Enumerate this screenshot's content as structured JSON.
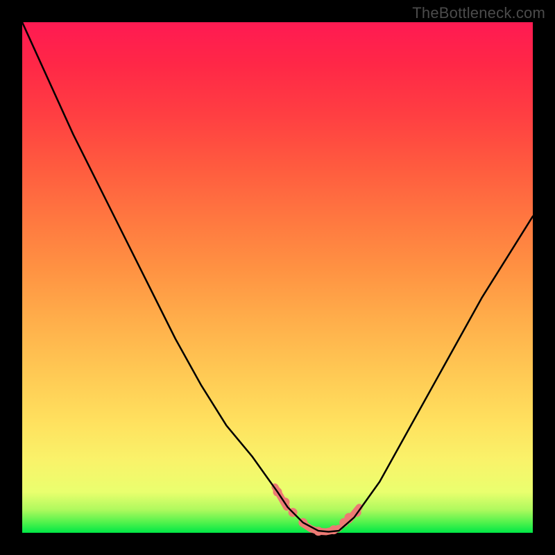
{
  "watermark": "TheBottleneck.com",
  "colors": {
    "frame": "#000000",
    "curve": "#000000",
    "accent": "#ed7a74",
    "gradient_top": "#ff1a52",
    "gradient_bottom": "#00e846"
  },
  "chart_data": {
    "type": "line",
    "title": "",
    "xlabel": "",
    "ylabel": "",
    "xlim": [
      0,
      100
    ],
    "ylim": [
      0,
      100
    ],
    "grid": false,
    "legend": false,
    "x": [
      0,
      5,
      10,
      15,
      20,
      25,
      30,
      35,
      40,
      45,
      50,
      52,
      55,
      58,
      60,
      62,
      65,
      70,
      75,
      80,
      85,
      90,
      95,
      100
    ],
    "y": [
      100,
      89,
      78,
      68,
      58,
      48,
      38,
      29,
      21,
      15,
      8,
      5,
      2,
      0.4,
      0.2,
      0.4,
      3,
      10,
      19,
      28,
      37,
      46,
      54,
      62
    ],
    "accent_markers_x": [
      50,
      51.5,
      53,
      55,
      58,
      61,
      63,
      64,
      65.5
    ],
    "accent_markers_y": [
      8,
      6,
      4,
      2,
      0.3,
      0.6,
      2,
      3,
      4
    ]
  }
}
